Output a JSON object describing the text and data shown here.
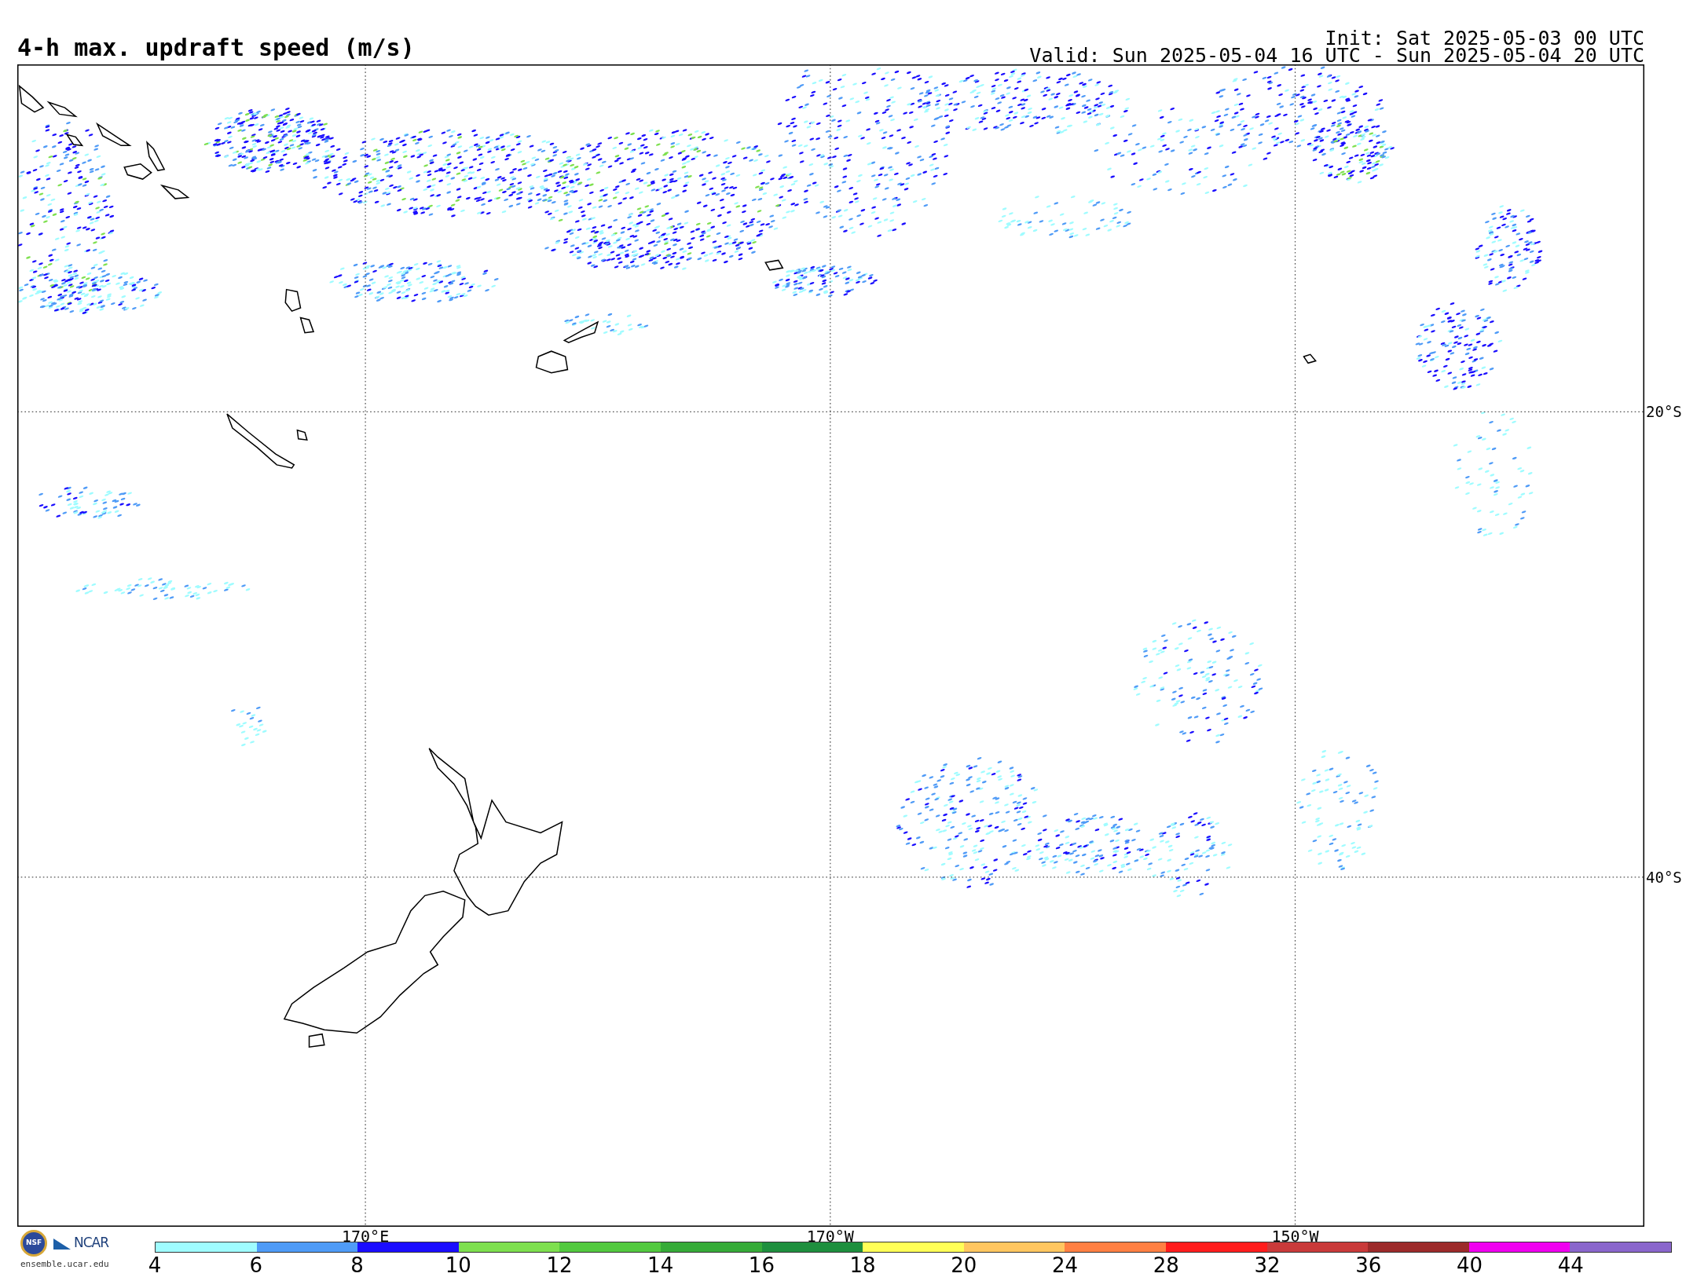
{
  "title": "4-h max. updraft speed (m/s)",
  "init": "Init: Sat 2025-05-03 00 UTC",
  "valid": "Valid: Sun 2025-05-04 16 UTC - Sun 2025-05-04 20 UTC",
  "lat_lines": [
    {
      "label": "20°S"
    },
    {
      "label": "40°S"
    }
  ],
  "lon_lines": [
    {
      "label": "170°E"
    },
    {
      "label": "170°W"
    },
    {
      "label": "150°W"
    }
  ],
  "logo": {
    "seal_text": "NSF",
    "org_text": "NCAR",
    "url": "ensemble.ucar.edu"
  },
  "colorbar": {
    "bins": [
      {
        "color": "#9ffcff"
      },
      {
        "color": "#4f9bf7"
      },
      {
        "color": "#1a0dff"
      },
      {
        "color": "#7ee04f"
      },
      {
        "color": "#52c93f"
      },
      {
        "color": "#36ab38"
      },
      {
        "color": "#1e8f3e"
      },
      {
        "color": "#ffff57"
      },
      {
        "color": "#ffc660"
      },
      {
        "color": "#ff8043"
      },
      {
        "color": "#ff1c1c"
      },
      {
        "color": "#c93a3a"
      },
      {
        "color": "#9c2a2a"
      },
      {
        "color": "#f000f0"
      },
      {
        "color": "#8a66cc"
      }
    ],
    "labels": [
      "4",
      "6",
      "8",
      "10",
      "12",
      "14",
      "16",
      "18",
      "20",
      "24",
      "28",
      "32",
      "36",
      "40",
      "44"
    ]
  }
}
